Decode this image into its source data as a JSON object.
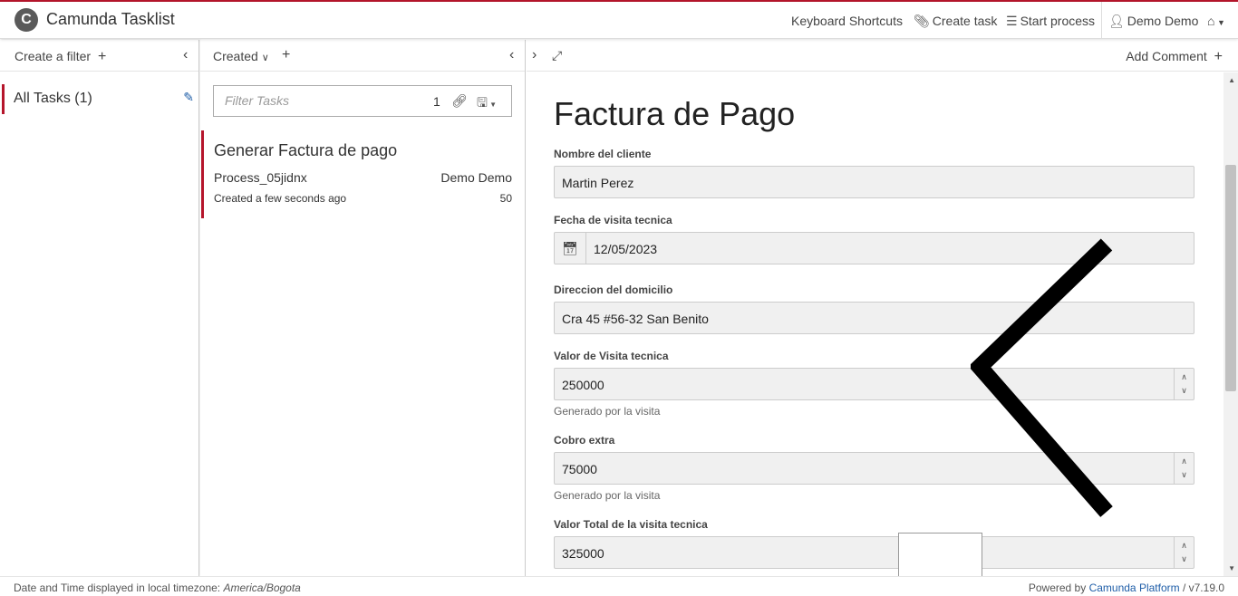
{
  "header": {
    "logo_letter": "C",
    "title": "Camunda Tasklist",
    "keyboard_shortcuts": "Keyboard Shortcuts",
    "create_task": "Create task",
    "start_process": "Start process",
    "user": "Demo Demo",
    "accent_color": "#b5152b"
  },
  "filters": {
    "create_filter": "Create a filter",
    "items": [
      {
        "label": "All Tasks (1)"
      }
    ]
  },
  "task_list": {
    "sort_label": "Created",
    "filter_placeholder": "Filter Tasks",
    "filter_count": "1",
    "tasks": [
      {
        "name": "Generar Factura de pago",
        "process": "Process_05jidnx",
        "assignee": "Demo Demo",
        "created": "Created a few seconds ago",
        "priority": "50"
      }
    ]
  },
  "task_form": {
    "add_comment": "Add Comment",
    "title": "Factura de Pago",
    "fields": {
      "cliente": {
        "label": "Nombre del cliente",
        "value": "Martin Perez"
      },
      "fecha": {
        "label": "Fecha de visita tecnica",
        "value": "12/05/2023"
      },
      "direccion": {
        "label": "Direccion del domicilio",
        "value": "Cra 45 #56-32 San Benito"
      },
      "valor": {
        "label": "Valor de Visita tecnica",
        "value": "250000",
        "helper": "Generado por la visita"
      },
      "cobro": {
        "label": "Cobro extra",
        "value": "75000",
        "helper": "Generado por la visita"
      },
      "total": {
        "label": "Valor Total de la visita tecnica",
        "value": "325000"
      }
    }
  },
  "footer": {
    "timezone_prefix": "Date and Time displayed in local timezone:",
    "timezone": "America/Bogota",
    "powered_by": "Powered by",
    "platform": "Camunda Platform",
    "version": "/ v7.19.0"
  }
}
